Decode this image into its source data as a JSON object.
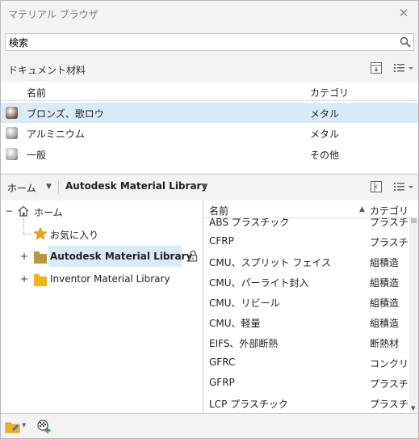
{
  "window": {
    "title": "マテリアル ブラウザ"
  },
  "search": {
    "value": "検索",
    "placeholder": "検索"
  },
  "document": {
    "label": "ドキュメント材料",
    "columns": {
      "name": "名前",
      "category": "カテゴリ"
    },
    "rows": [
      {
        "name": "ブロンズ、歌ロウ",
        "category": "メタル",
        "selected": true,
        "swatch": "#7a5a48"
      },
      {
        "name": "アルミニウム",
        "category": "メタル",
        "selected": false,
        "swatch": "#9a9a9a"
      },
      {
        "name": "一般",
        "category": "その他",
        "selected": false,
        "swatch": "#a8a8a8"
      }
    ]
  },
  "library_bar": {
    "home": "ホーム",
    "library": "Autodesk Material Library"
  },
  "tree": {
    "home": "ホーム",
    "favorites": "お気に入り",
    "autodesk_lib": "Autodesk Material Library",
    "inventor_lib": "Inventor Material Library",
    "expand_sign": "+",
    "collapse_sign": "−"
  },
  "library_list": {
    "columns": {
      "name": "名前",
      "category": "カテゴリ"
    },
    "rows": [
      {
        "name": "ABS プラスチック",
        "category": "プラスチ"
      },
      {
        "name": "CFRP",
        "category": "プラスチ"
      },
      {
        "name": "CMU、スプリット フェイス",
        "category": "組積造"
      },
      {
        "name": "CMU、パーライト封入",
        "category": "組積造"
      },
      {
        "name": "CMU、リビール",
        "category": "組積造"
      },
      {
        "name": "CMU、軽量",
        "category": "組積造"
      },
      {
        "name": "EIFS、外部断熱",
        "category": "断熱材"
      },
      {
        "name": "GFRC",
        "category": "コンクリ"
      },
      {
        "name": "GFRP",
        "category": "プラスチ"
      },
      {
        "name": "LCP プラスチック",
        "category": "プラスチ"
      }
    ]
  },
  "colors": {
    "selection": "#d9ebf7",
    "folder_gold": "#b8973a",
    "folder_orange": "#f2b31b",
    "star": "#f0a21a"
  }
}
